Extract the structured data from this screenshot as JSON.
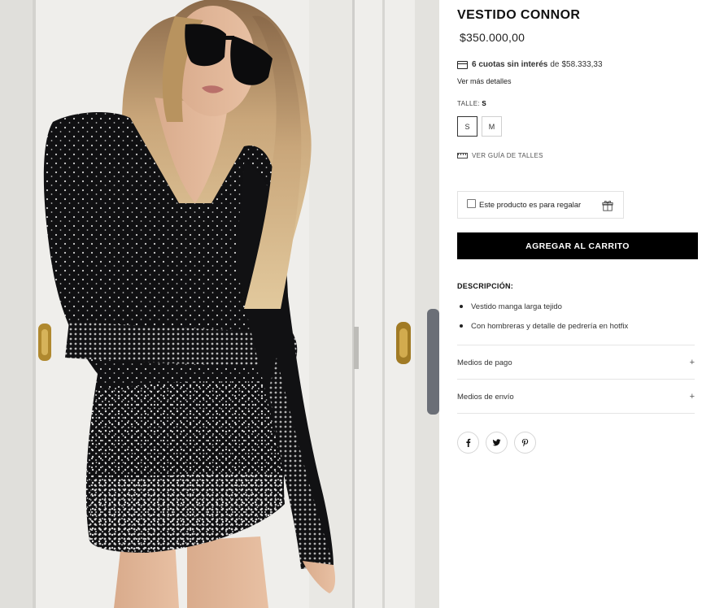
{
  "product": {
    "title": "VESTIDO CONNOR",
    "price": "$350.000,00",
    "installments_bold": "6 cuotas sin interés",
    "installments_of": "de",
    "installments_amount": "$58.333,33",
    "more_details": "Ver más detalles"
  },
  "size": {
    "label": "TALLE:",
    "selected": "S",
    "options": [
      "S",
      "M"
    ],
    "guide_link": "VER GUÍA DE TALLES"
  },
  "gift": {
    "label": "Este producto es para regalar"
  },
  "cart": {
    "add_label": "AGREGAR AL CARRITO"
  },
  "description": {
    "title": "DESCRIPCIÓN:",
    "items": [
      "Vestido manga larga tejido",
      "Con hombreras y detalle de pedrería en hotfix"
    ]
  },
  "accordions": [
    {
      "label": "Medios de pago",
      "icon": "+"
    },
    {
      "label": "Medios de envío",
      "icon": "+"
    }
  ],
  "social": [
    "facebook-icon",
    "twitter-icon",
    "pinterest-icon"
  ],
  "colors": {
    "button_bg": "#000000",
    "button_text": "#ffffff",
    "divider": "#e5e5e5"
  }
}
